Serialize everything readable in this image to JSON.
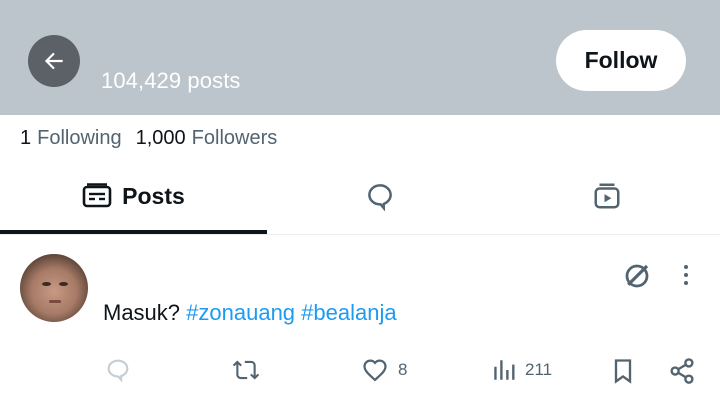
{
  "profile": {
    "post_count": "104,429 posts",
    "follow_label": "Follow",
    "following_count": "1",
    "following_label": "Following",
    "followers_count": "1,000",
    "followers_label": "Followers"
  },
  "tabs": [
    {
      "label": "Posts",
      "icon": "posts-icon",
      "selected": true
    },
    {
      "label": "",
      "icon": "replies-icon",
      "selected": false
    },
    {
      "label": "",
      "icon": "media-icon",
      "selected": false
    }
  ],
  "post": {
    "text_prefix": "Masuk? ",
    "hashtags": [
      "#zonauang",
      "#bealanja"
    ],
    "likes": "8",
    "views": "211"
  },
  "colors": {
    "banner": "#bcc5cc",
    "link": "#1d9bf0",
    "muted": "#536471",
    "text": "#0f1419"
  }
}
